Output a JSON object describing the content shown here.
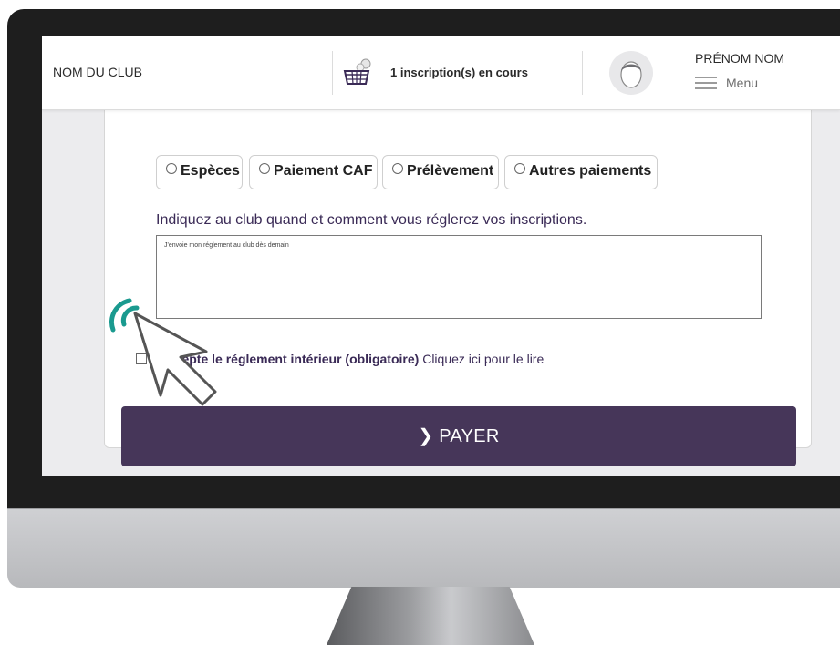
{
  "header": {
    "club_name": "NOM DU CLUB",
    "cart_text": "1 inscription(s) en cours",
    "user_name": "PRÉNOM NOM",
    "menu_label": "Menu"
  },
  "payment_options": [
    "Espèces",
    "Paiement CAF",
    "Prélèvement",
    "Autres paiements"
  ],
  "comment": {
    "question": "Indiquez au club quand et comment vous réglerez vos inscriptions.",
    "value": "J'envoie mon réglement au club dès demain"
  },
  "rules": {
    "bold_text": "J'accepte le réglement intérieur (obligatoire)",
    "link_text": "Cliquez ici pour le lire",
    "checked": false
  },
  "pay_button": {
    "label": "PAYER"
  },
  "colors": {
    "accent": "#463659",
    "cursor_ring": "#1a9a8f"
  }
}
